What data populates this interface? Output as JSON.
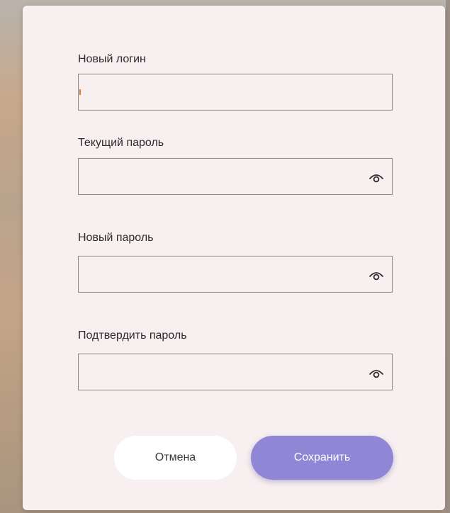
{
  "form": {
    "new_login": {
      "label": "Новый логин",
      "value": "",
      "placeholder": ""
    },
    "current_password": {
      "label": "Текущий пароль",
      "value": "",
      "placeholder": "",
      "toggle_icon": "eye-icon"
    },
    "new_password": {
      "label": "Новый пароль",
      "value": "",
      "placeholder": "",
      "toggle_icon": "eye-icon"
    },
    "confirm_password": {
      "label": "Подтвердить пароль",
      "value": "",
      "placeholder": "",
      "toggle_icon": "eye-icon"
    }
  },
  "buttons": {
    "cancel_label": "Отмена",
    "save_label": "Сохранить"
  },
  "colors": {
    "dialog_background": "#f8eff0",
    "field_border": "#8d8688",
    "save_button": "#8f86d6",
    "cancel_button": "#ffffff"
  }
}
